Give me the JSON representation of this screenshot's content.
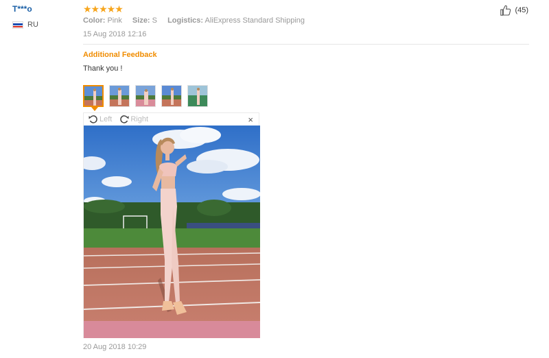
{
  "reviewer": {
    "name": "T***o",
    "country": "RU",
    "flag_icon": "russia-flag-icon"
  },
  "review": {
    "rating_stars": "★★★★★",
    "rating": 5,
    "attributes": [
      {
        "key": "Color:",
        "value": "Pink"
      },
      {
        "key": "Size:",
        "value": "S"
      },
      {
        "key": "Logistics:",
        "value": "AliExpress Standard Shipping"
      }
    ],
    "date": "15 Aug 2018 12:16"
  },
  "likes": {
    "count": "(45)",
    "icon": "thumbs-up-icon"
  },
  "additional_feedback": {
    "title": "Additional Feedback",
    "text": "Thank you !",
    "date": "20 Aug 2018 10:29"
  },
  "viewer": {
    "rotate_left_label": "Left",
    "rotate_right_label": "Right",
    "close_label": "×"
  },
  "colors": {
    "accent": "#f08c00",
    "link": "#1a5fa6",
    "star": "#f7a51c"
  }
}
